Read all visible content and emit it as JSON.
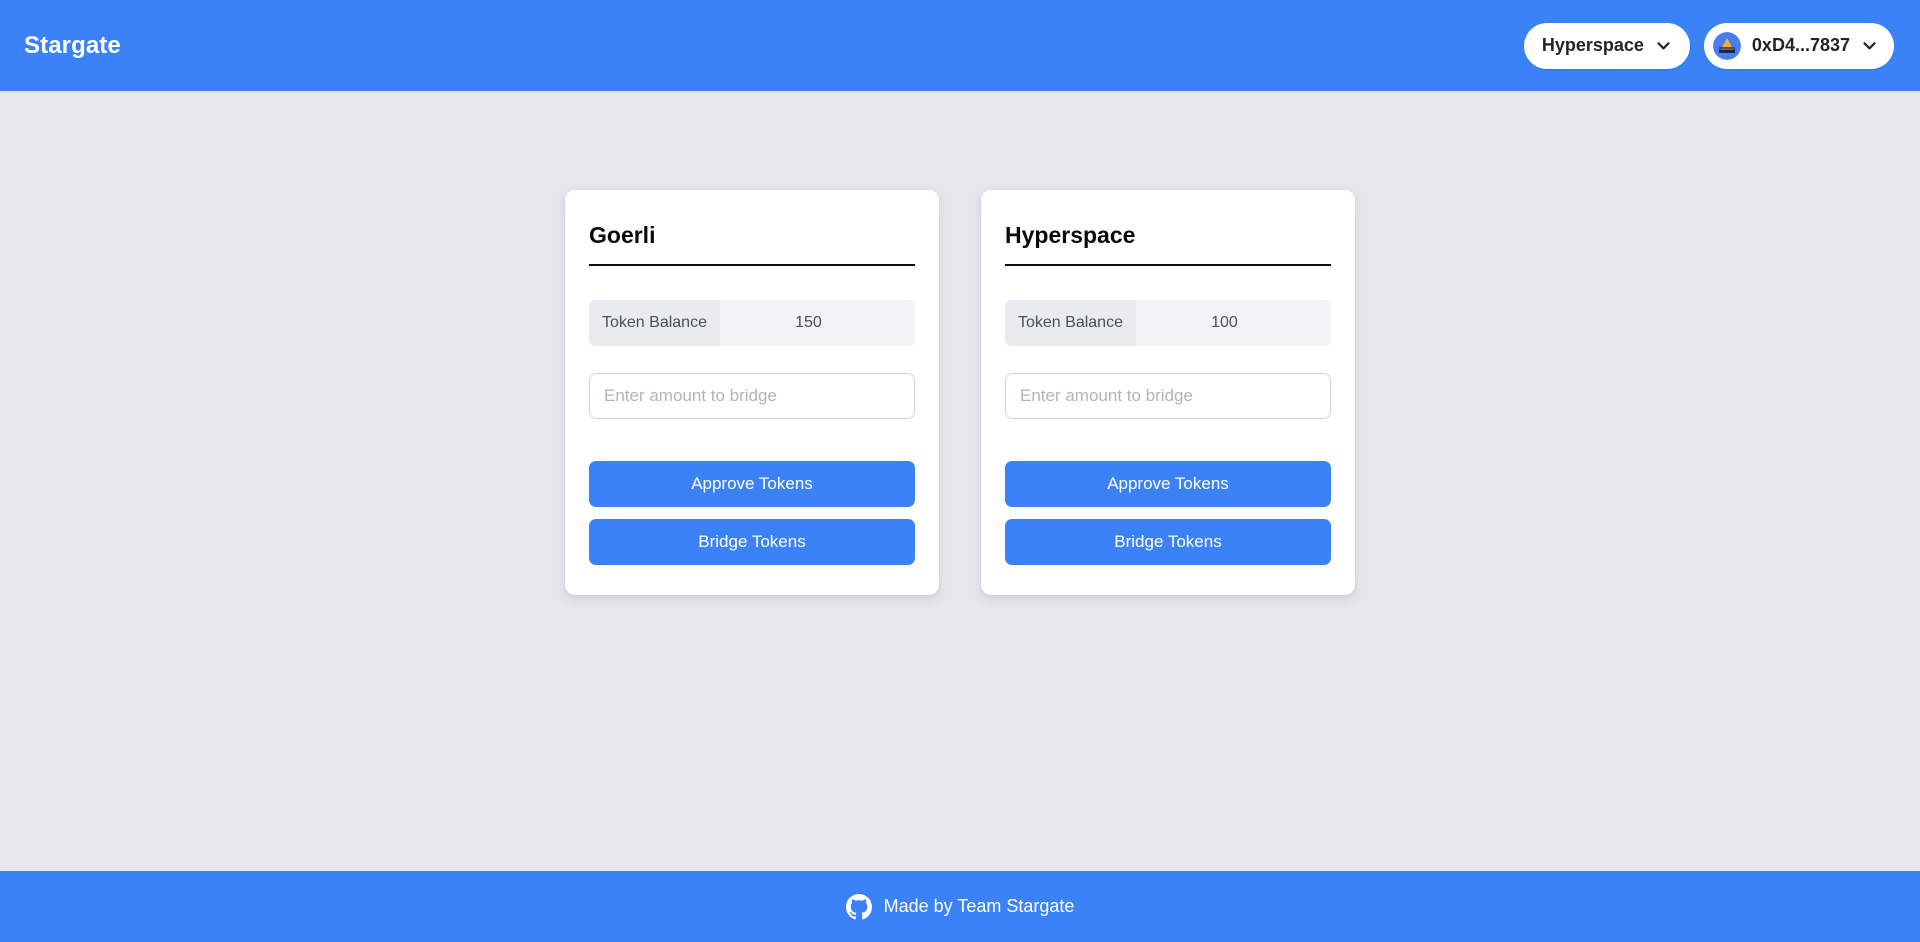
{
  "navbar": {
    "brand": "Stargate",
    "network_selector": {
      "label": "Hyperspace",
      "icon": "chevron-down-icon"
    },
    "account": {
      "address": "0xD4...7837",
      "avatar_icon": "blockie-avatar-icon",
      "icon": "chevron-down-icon"
    },
    "background_color": "#3b82f6"
  },
  "main": {
    "background_color": "#e5e7eb",
    "cards": [
      {
        "title": "Goerli",
        "balance_label": "Token Balance",
        "balance_value": "150",
        "amount_placeholder": "Enter amount to bridge",
        "amount_value": "",
        "approve_label": "Approve Tokens",
        "bridge_label": "Bridge Tokens"
      },
      {
        "title": "Hyperspace",
        "balance_label": "Token Balance",
        "balance_value": "100",
        "amount_placeholder": "Enter amount to bridge",
        "amount_value": "",
        "approve_label": "Approve Tokens",
        "bridge_label": "Bridge Tokens"
      }
    ]
  },
  "footer": {
    "text": "Made by Team Stargate",
    "icon": "github-icon",
    "background_color": "#3b82f6"
  },
  "colors": {
    "accent": "#3b82f6",
    "page_background": "#e5e7eb",
    "card_background": "#ffffff",
    "muted_text": "#495057"
  }
}
